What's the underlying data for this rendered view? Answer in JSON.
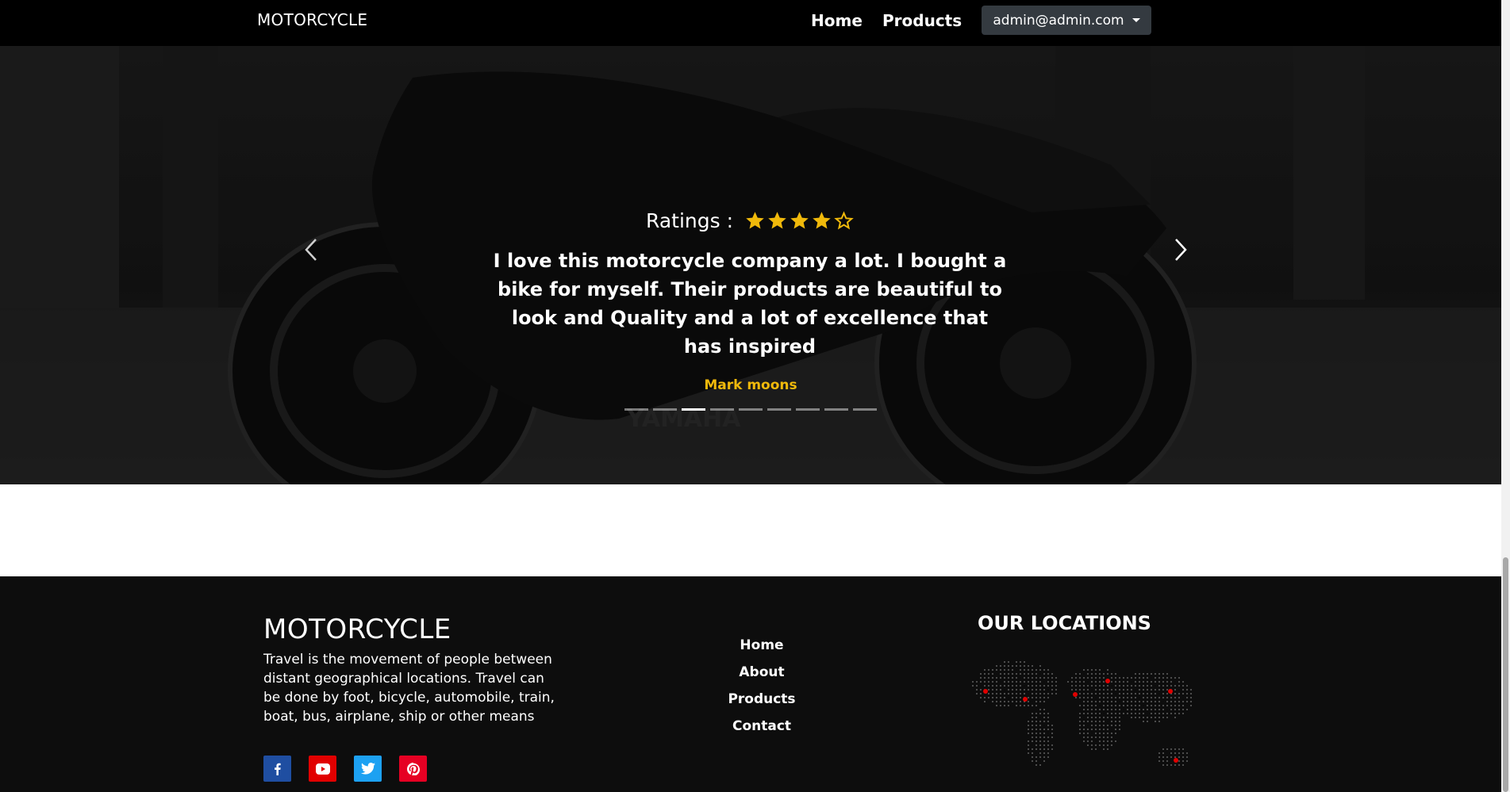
{
  "navbar": {
    "brand": "MOTORCYCLE",
    "links": [
      {
        "label": "Home"
      },
      {
        "label": "Products"
      }
    ],
    "user_email": "admin@admin.com"
  },
  "hero": {
    "background_image": "black-motorcycle-photo",
    "ratings_label": "Ratings :",
    "rating_value": 4,
    "rating_max": 5,
    "quote": "I love this motorcycle company a lot. I bought a bike for myself. Their products are beautiful to look and Quality and a lot of excellence that has inspired",
    "author": "Mark moons",
    "indicator_count": 9,
    "active_indicator": 3,
    "prev_icon": "chevron-left-icon",
    "next_icon": "chevron-right-icon"
  },
  "footer": {
    "brand": "MOTORCYCLE",
    "description": "Travel is the movement of people between distant geographical locations. Travel can be done by foot, bicycle, automobile, train, boat, bus, airplane, ship or other means",
    "links": [
      {
        "label": "Home"
      },
      {
        "label": "About"
      },
      {
        "label": "Products"
      },
      {
        "label": "Contact"
      }
    ],
    "locations_title": "OUR LOCATIONS",
    "social": [
      {
        "name": "facebook-icon",
        "color": "#1f4ea1"
      },
      {
        "name": "youtube-icon",
        "color": "#e10000"
      },
      {
        "name": "twitter-icon",
        "color": "#1da1f2"
      },
      {
        "name": "pinterest-icon",
        "color": "#e60023"
      }
    ]
  },
  "colors": {
    "accent": "#f0b90b",
    "navbar_bg": "#000000",
    "footer_bg": "#0d0d0d",
    "map_marker": "#e00000"
  }
}
